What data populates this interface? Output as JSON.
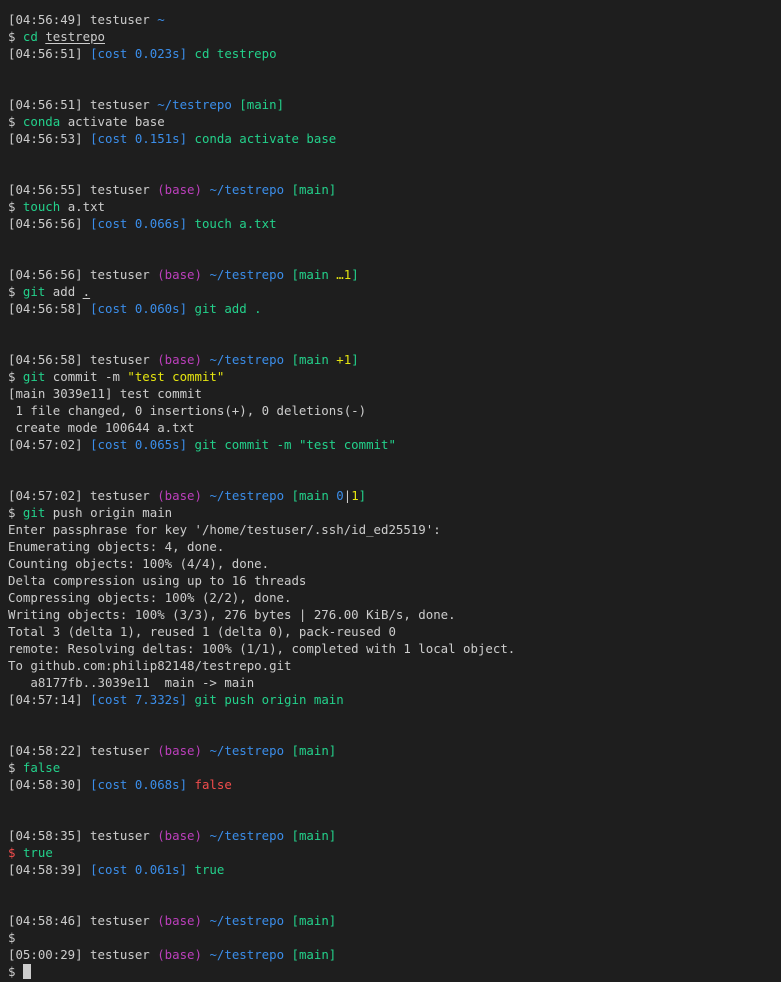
{
  "colors": {
    "default": "#cccccc",
    "blue": "#3b8eea",
    "cyan": "#29b8db",
    "green": "#23d18b",
    "magenta": "#bc3fbc",
    "yellow": "#e5e510",
    "red": "#f14c4c",
    "background": "#1e1e1e"
  },
  "terminal": {
    "lines": [
      {
        "segs": [
          {
            "t": "[04:56:49] testuser "
          },
          {
            "t": "~",
            "c": "blue"
          }
        ]
      },
      {
        "segs": [
          {
            "t": "$ "
          },
          {
            "t": "cd",
            "c": "green"
          },
          {
            "t": " "
          },
          {
            "t": "testrepo",
            "u": true
          }
        ]
      },
      {
        "segs": [
          {
            "t": "[04:56:51] "
          },
          {
            "t": "[cost 0.023s]",
            "c": "blue"
          },
          {
            "t": " cd testrepo",
            "c": "green"
          }
        ]
      },
      {
        "segs": []
      },
      {
        "segs": []
      },
      {
        "segs": [
          {
            "t": "[04:56:51] testuser "
          },
          {
            "t": "~/testrepo",
            "c": "blue"
          },
          {
            "t": " [main]",
            "c": "green"
          }
        ]
      },
      {
        "segs": [
          {
            "t": "$ "
          },
          {
            "t": "conda",
            "c": "green"
          },
          {
            "t": " activate base"
          }
        ]
      },
      {
        "segs": [
          {
            "t": "[04:56:53] "
          },
          {
            "t": "[cost 0.151s]",
            "c": "blue"
          },
          {
            "t": " conda activate base",
            "c": "green"
          }
        ]
      },
      {
        "segs": []
      },
      {
        "segs": []
      },
      {
        "segs": [
          {
            "t": "[04:56:55] testuser "
          },
          {
            "t": "(base)",
            "c": "magenta"
          },
          {
            "t": " "
          },
          {
            "t": "~/testrepo",
            "c": "blue"
          },
          {
            "t": " [main]",
            "c": "green"
          }
        ]
      },
      {
        "segs": [
          {
            "t": "$ "
          },
          {
            "t": "touch",
            "c": "green"
          },
          {
            "t": " a.txt"
          }
        ]
      },
      {
        "segs": [
          {
            "t": "[04:56:56] "
          },
          {
            "t": "[cost 0.066s]",
            "c": "blue"
          },
          {
            "t": " touch a.txt",
            "c": "green"
          }
        ]
      },
      {
        "segs": []
      },
      {
        "segs": []
      },
      {
        "segs": [
          {
            "t": "[04:56:56] testuser "
          },
          {
            "t": "(base)",
            "c": "magenta"
          },
          {
            "t": " "
          },
          {
            "t": "~/testrepo",
            "c": "blue"
          },
          {
            "t": " [main ",
            "c": "green"
          },
          {
            "t": "…1",
            "c": "yellow"
          },
          {
            "t": "]",
            "c": "green"
          }
        ]
      },
      {
        "segs": [
          {
            "t": "$ "
          },
          {
            "t": "git",
            "c": "green"
          },
          {
            "t": " add "
          },
          {
            "t": ".",
            "u": true
          }
        ]
      },
      {
        "segs": [
          {
            "t": "[04:56:58] "
          },
          {
            "t": "[cost 0.060s]",
            "c": "blue"
          },
          {
            "t": " git add .",
            "c": "green"
          }
        ]
      },
      {
        "segs": []
      },
      {
        "segs": []
      },
      {
        "segs": [
          {
            "t": "[04:56:58] testuser "
          },
          {
            "t": "(base)",
            "c": "magenta"
          },
          {
            "t": " "
          },
          {
            "t": "~/testrepo",
            "c": "blue"
          },
          {
            "t": " [main ",
            "c": "green"
          },
          {
            "t": "+1",
            "c": "yellow"
          },
          {
            "t": "]",
            "c": "green"
          }
        ]
      },
      {
        "segs": [
          {
            "t": "$ "
          },
          {
            "t": "git",
            "c": "green"
          },
          {
            "t": " commit -m "
          },
          {
            "t": "\"test commit\"",
            "c": "yellow"
          }
        ]
      },
      {
        "segs": [
          {
            "t": "[main 3039e11] test commit"
          }
        ]
      },
      {
        "segs": [
          {
            "t": " 1 file changed, 0 insertions(+), 0 deletions(-)"
          }
        ]
      },
      {
        "segs": [
          {
            "t": " create mode 100644 a.txt"
          }
        ]
      },
      {
        "segs": [
          {
            "t": "[04:57:02] "
          },
          {
            "t": "[cost 0.065s]",
            "c": "blue"
          },
          {
            "t": " git commit -m \"test commit\"",
            "c": "green"
          }
        ]
      },
      {
        "segs": []
      },
      {
        "segs": []
      },
      {
        "segs": [
          {
            "t": "[04:57:02] testuser "
          },
          {
            "t": "(base)",
            "c": "magenta"
          },
          {
            "t": " "
          },
          {
            "t": "~/testrepo",
            "c": "blue"
          },
          {
            "t": " [main ",
            "c": "green"
          },
          {
            "t": "0",
            "c": "blue"
          },
          {
            "t": "|",
            "c": "default"
          },
          {
            "t": "1",
            "c": "yellow"
          },
          {
            "t": "]",
            "c": "green"
          }
        ]
      },
      {
        "segs": [
          {
            "t": "$ "
          },
          {
            "t": "git",
            "c": "green"
          },
          {
            "t": " push origin main"
          }
        ]
      },
      {
        "segs": [
          {
            "t": "Enter passphrase for key '/home/testuser/.ssh/id_ed25519':"
          }
        ]
      },
      {
        "segs": [
          {
            "t": "Enumerating objects: 4, done."
          }
        ]
      },
      {
        "segs": [
          {
            "t": "Counting objects: 100% (4/4), done."
          }
        ]
      },
      {
        "segs": [
          {
            "t": "Delta compression using up to 16 threads"
          }
        ]
      },
      {
        "segs": [
          {
            "t": "Compressing objects: 100% (2/2), done."
          }
        ]
      },
      {
        "segs": [
          {
            "t": "Writing objects: 100% (3/3), 276 bytes | 276.00 KiB/s, done."
          }
        ]
      },
      {
        "segs": [
          {
            "t": "Total 3 (delta 1), reused 1 (delta 0), pack-reused 0"
          }
        ]
      },
      {
        "segs": [
          {
            "t": "remote: Resolving deltas: 100% (1/1), completed with 1 local object."
          }
        ]
      },
      {
        "segs": [
          {
            "t": "To github.com:philip82148/testrepo.git"
          }
        ]
      },
      {
        "segs": [
          {
            "t": "   a8177fb..3039e11  main -> main"
          }
        ]
      },
      {
        "segs": [
          {
            "t": "[04:57:14] "
          },
          {
            "t": "[cost 7.332s]",
            "c": "blue"
          },
          {
            "t": " git push origin main",
            "c": "green"
          }
        ]
      },
      {
        "segs": []
      },
      {
        "segs": []
      },
      {
        "segs": [
          {
            "t": "[04:58:22] testuser "
          },
          {
            "t": "(base)",
            "c": "magenta"
          },
          {
            "t": " "
          },
          {
            "t": "~/testrepo",
            "c": "blue"
          },
          {
            "t": " [main]",
            "c": "green"
          }
        ]
      },
      {
        "segs": [
          {
            "t": "$ "
          },
          {
            "t": "false",
            "c": "green"
          }
        ]
      },
      {
        "segs": [
          {
            "t": "[04:58:30] "
          },
          {
            "t": "[cost 0.068s]",
            "c": "blue"
          },
          {
            "t": " false",
            "c": "red"
          }
        ]
      },
      {
        "segs": []
      },
      {
        "segs": []
      },
      {
        "segs": [
          {
            "t": "[04:58:35] testuser "
          },
          {
            "t": "(base)",
            "c": "magenta"
          },
          {
            "t": " "
          },
          {
            "t": "~/testrepo",
            "c": "blue"
          },
          {
            "t": " [main]",
            "c": "green"
          }
        ]
      },
      {
        "segs": [
          {
            "t": "$",
            "c": "red"
          },
          {
            "t": " "
          },
          {
            "t": "true",
            "c": "green"
          }
        ]
      },
      {
        "segs": [
          {
            "t": "[04:58:39] "
          },
          {
            "t": "[cost 0.061s]",
            "c": "blue"
          },
          {
            "t": " true",
            "c": "green"
          }
        ]
      },
      {
        "segs": []
      },
      {
        "segs": []
      },
      {
        "segs": [
          {
            "t": "[04:58:46] testuser "
          },
          {
            "t": "(base)",
            "c": "magenta"
          },
          {
            "t": " "
          },
          {
            "t": "~/testrepo",
            "c": "blue"
          },
          {
            "t": " [main]",
            "c": "green"
          }
        ]
      },
      {
        "segs": [
          {
            "t": "$"
          }
        ]
      },
      {
        "segs": [
          {
            "t": "[05:00:29] testuser "
          },
          {
            "t": "(base)",
            "c": "magenta"
          },
          {
            "t": " "
          },
          {
            "t": "~/testrepo",
            "c": "blue"
          },
          {
            "t": " [main]",
            "c": "green"
          }
        ]
      },
      {
        "segs": [
          {
            "t": "$ "
          }
        ],
        "cursor": true
      }
    ]
  }
}
